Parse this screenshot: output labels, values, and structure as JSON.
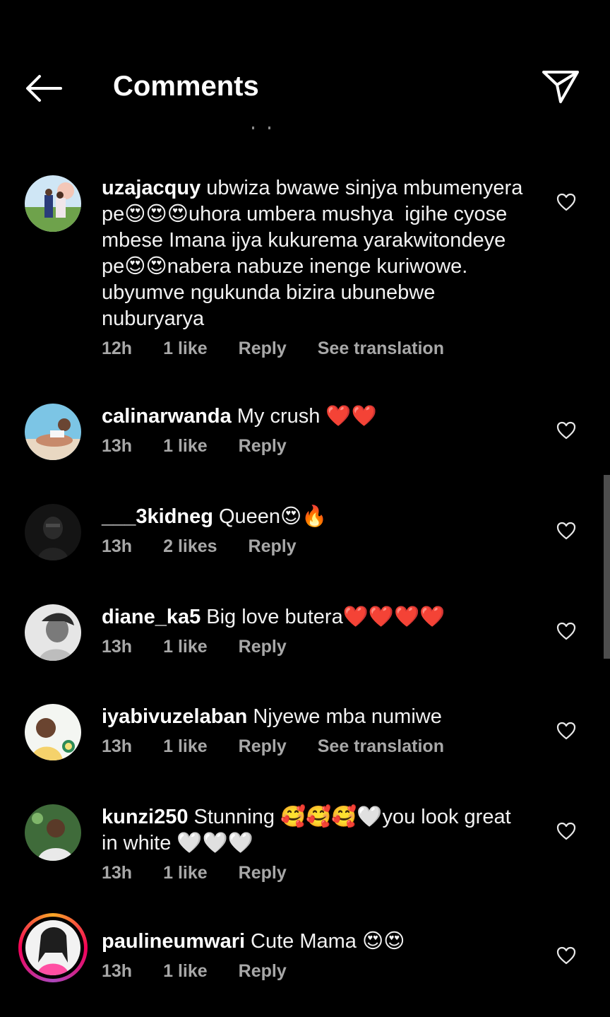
{
  "header": {
    "title": "Comments",
    "back_icon": "arrow-left-icon",
    "share_icon": "paper-plane-icon"
  },
  "colors": {
    "background": "#000000",
    "meta_text": "#a8a8a8",
    "story_ring": "#f50057"
  },
  "comments": [
    {
      "username": "uzajacquy",
      "text": "ubwiza bwawe sinjya mbumenyera pe😍😍😍uhora umbera mushya  igihe cyose mbese Imana ijya kukurema yarakwitondeye pe😍😍nabera nabuze inenge kuriwowe. ubyumve ngukunda bizira ubunebwe nuburyarya",
      "time": "12h",
      "likes": "1 like",
      "reply": "Reply",
      "translate": "See translation"
    },
    {
      "username": "calinarwanda",
      "text": "My crush ❤️❤️",
      "time": "13h",
      "likes": "1 like",
      "reply": "Reply"
    },
    {
      "username": "___3kidneg",
      "text": "Queen😍🔥",
      "time": "13h",
      "likes": "2 likes",
      "reply": "Reply"
    },
    {
      "username": "diane_ka5",
      "text": "Big love butera❤️❤️❤️❤️",
      "time": "13h",
      "likes": "1 like",
      "reply": "Reply"
    },
    {
      "username": "iyabivuzelaban",
      "text": "Njyewe mba numiwe",
      "time": "13h",
      "likes": "1 like",
      "reply": "Reply",
      "translate": "See translation"
    },
    {
      "username": "kunzi250",
      "text": "Stunning 🥰🥰🥰🤍you look great in white 🤍🤍🤍",
      "time": "13h",
      "likes": "1 like",
      "reply": "Reply"
    },
    {
      "username": "paulineumwari",
      "text": "Cute Mama 😍😍",
      "time": "13h",
      "likes": "1 like",
      "reply": "Reply"
    }
  ]
}
